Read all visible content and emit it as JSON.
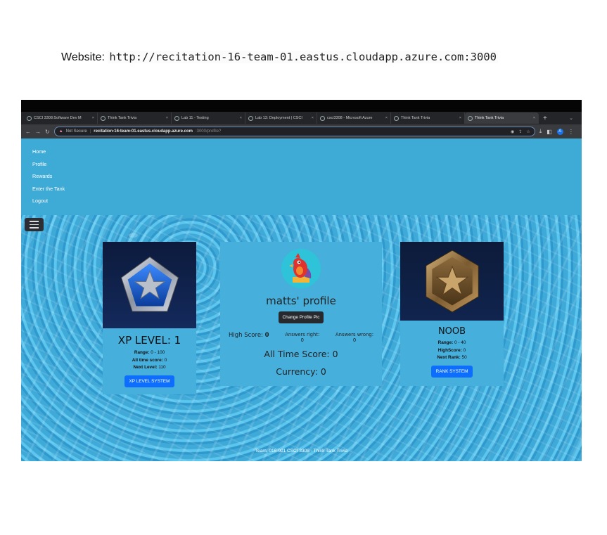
{
  "caption": {
    "label": "Website:",
    "url": "http://recitation-16-team-01.eastus.cloudapp.azure.com:3000"
  },
  "browser": {
    "tabs": [
      {
        "title": "CSCI 3308:Software Dev M"
      },
      {
        "title": "Think Tank Trivia"
      },
      {
        "title": "Lab 11 - Testing"
      },
      {
        "title": "Lab 13: Deployment | CSCI"
      },
      {
        "title": "csci3308 - Microsoft Azure"
      },
      {
        "title": "Think Tank Trivia"
      },
      {
        "title": "Think Tank Trivia",
        "active": true
      }
    ],
    "security_label": "Not Secure",
    "address_host": "recitation-16-team-01.eastus.cloudapp.azure.com",
    "address_path": ":3000/profile?",
    "profile_initial": "A"
  },
  "nav": {
    "items": [
      "Home",
      "Profile",
      "Rewards",
      "Enter the Tank",
      "Logout"
    ]
  },
  "xp_card": {
    "title": "XP LEVEL: 1",
    "range_label": "Range:",
    "range_value": " 0 - 100",
    "alltime_label": "All time score:",
    "alltime_value": " 0",
    "next_label": "Next Level:",
    "next_value": " 110",
    "button": "XP LEVEL SYSTEM"
  },
  "profile_card": {
    "name": "matts' profile",
    "change_pic_button": "Change Profile Pic",
    "high_score_label": "High Score:",
    "high_score_value": "0",
    "answers_right_label": "Answers right:",
    "answers_right_value": "0",
    "answers_wrong_label": "Answers wrong:",
    "answers_wrong_value": "0",
    "all_time_label": "All Time Score:",
    "all_time_value": "0",
    "currency_label": "Currency:",
    "currency_value": "0"
  },
  "rank_card": {
    "title": "NOOB",
    "range_label": "Range:",
    "range_value": " 0 - 40",
    "highscore_label": "HighScore:",
    "highscore_value": " 0",
    "next_label": "Next Rank:",
    "next_value": " 50",
    "button": "RANK SYSTEM"
  },
  "footer": {
    "text": "Team: 016-001  CSCI 3308 - Think Tank Trivia"
  }
}
